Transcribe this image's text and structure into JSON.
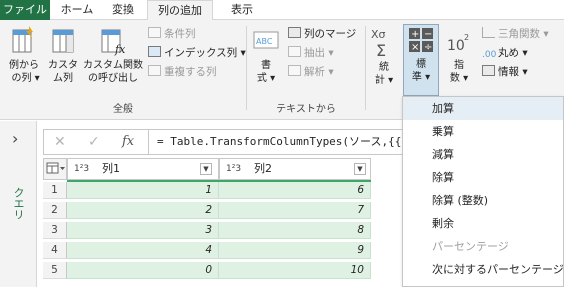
{
  "tabs": [
    "ファイル",
    "ホーム",
    "変換",
    "列の追加",
    "表示"
  ],
  "ribbon": {
    "general": {
      "example_column": "例から\n の列 ▾",
      "custom_column": "カスタ\nム列",
      "invoke_custom_function": "カスタム関数\nの呼び出し",
      "conditional_column": "条件列",
      "index_column": "インデックス列 ▾",
      "duplicate_column": "重複する列",
      "group_label": "全般"
    },
    "text": {
      "format": "書\n式 ▾",
      "merge_columns": "列のマージ",
      "extract": "抽出 ▾",
      "parse": "解析 ▾",
      "group_label": "テキストから"
    },
    "number": {
      "statistics": "統\n計 ▾",
      "standard": "標\n準 ▾",
      "scientific": "指\n数 ▾",
      "trigonometry": "三角関数 ▾",
      "rounding": "丸め ▾",
      "information": "情報 ▾"
    }
  },
  "formula_bar": {
    "cancel_glyph": "✕",
    "commit_glyph": "✓",
    "fx_glyph": "fx",
    "formula_text": "= Table.TransformColumnTypes(ソース,{{\"列"
  },
  "side_panel": {
    "expand_glyph": "›",
    "queries_label": "クエリ"
  },
  "table": {
    "type_glyph": "1²3",
    "columns": [
      "列1",
      "列2"
    ],
    "rows": [
      {
        "n": "1",
        "c1": "1",
        "c2": "6"
      },
      {
        "n": "2",
        "c1": "2",
        "c2": "7"
      },
      {
        "n": "3",
        "c1": "3",
        "c2": "8"
      },
      {
        "n": "4",
        "c1": "4",
        "c2": "9"
      },
      {
        "n": "5",
        "c1": "0",
        "c2": "10"
      }
    ]
  },
  "standard_menu": {
    "items": [
      {
        "label": "加算",
        "state": "highlighted"
      },
      {
        "label": "乗算",
        "state": "enabled"
      },
      {
        "label": "減算",
        "state": "enabled"
      },
      {
        "label": "除算",
        "state": "enabled"
      },
      {
        "label": "除算 (整数)",
        "state": "enabled"
      },
      {
        "label": "剰余",
        "state": "enabled"
      },
      {
        "label": "パーセンテージ",
        "state": "disabled"
      },
      {
        "label": "次に対するパーセンテージ",
        "state": "enabled"
      }
    ]
  },
  "colors": {
    "file_tab": "#217346",
    "data_cell": "#dff1e3",
    "column_bar": "#3fa66a",
    "menu_highlight": "#e5eef5",
    "selected_button": "#cfe2ee"
  }
}
